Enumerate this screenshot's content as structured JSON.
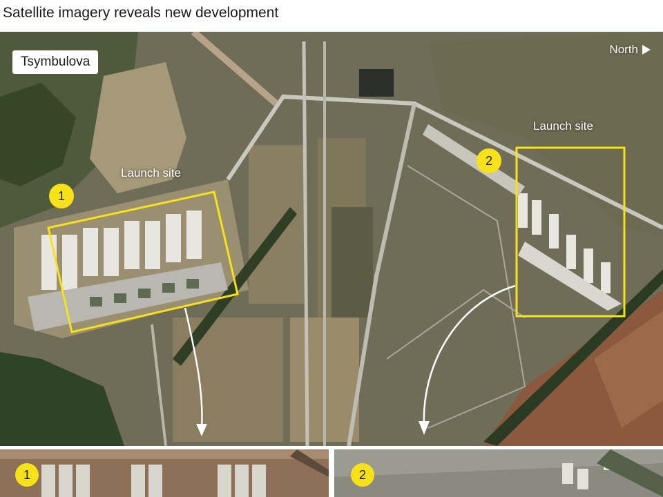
{
  "header": {
    "title": "Satellite imagery reveals new development"
  },
  "map": {
    "place_label": "Tsymbulova",
    "north_label": "North",
    "site_1": {
      "label": "Launch site",
      "marker": "1"
    },
    "site_2": {
      "label": "Launch site",
      "marker": "2"
    },
    "highlight_color": "#f7e21a"
  },
  "insets": [
    {
      "marker": "1"
    },
    {
      "marker": "2"
    }
  ]
}
